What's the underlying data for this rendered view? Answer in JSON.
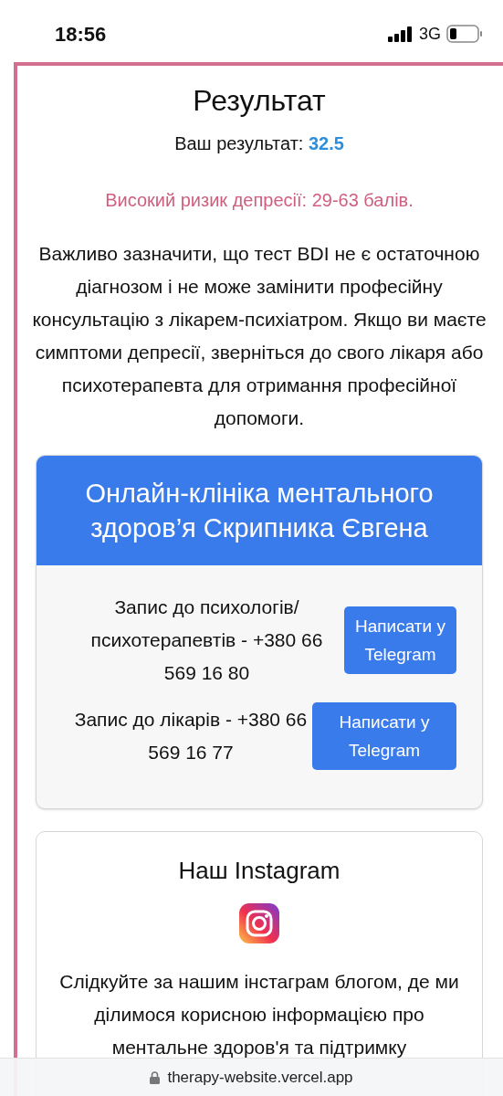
{
  "status_bar": {
    "time": "18:56",
    "network": "3G"
  },
  "result": {
    "title": "Результат",
    "score_label": "Ваш результат:",
    "score": "32.5",
    "risk": "Високий ризик депресії: 29-63 балів.",
    "note": "Важливо зазначити, що тест BDI не є остаточною діагнозом і не може замінити професійну консультацію з лікарем-психіатром. Якщо ви маєте симптоми депресії, зверніться до свого лікаря або психотерапевта для отримання професійної допомоги."
  },
  "clinic": {
    "title": "Онлайн-клініка ментального здоров’я Скрипника Євгена",
    "rows": [
      {
        "text": "Запис до психологів/ психотерапевтів - +380 66 569 16 80",
        "button": "Написати у Telegram"
      },
      {
        "text": "Запис до лікарів - +380 66 569 16 77",
        "button": "Написати у Telegram"
      }
    ]
  },
  "instagram": {
    "title": "Наш Instagram",
    "text": "Слідкуйте за нашим інстаграм блогом, де ми ділимося корисною інформацією про ментальне здоров'я та підтримку"
  },
  "url_bar": {
    "url": "therapy-website.vercel.app"
  }
}
